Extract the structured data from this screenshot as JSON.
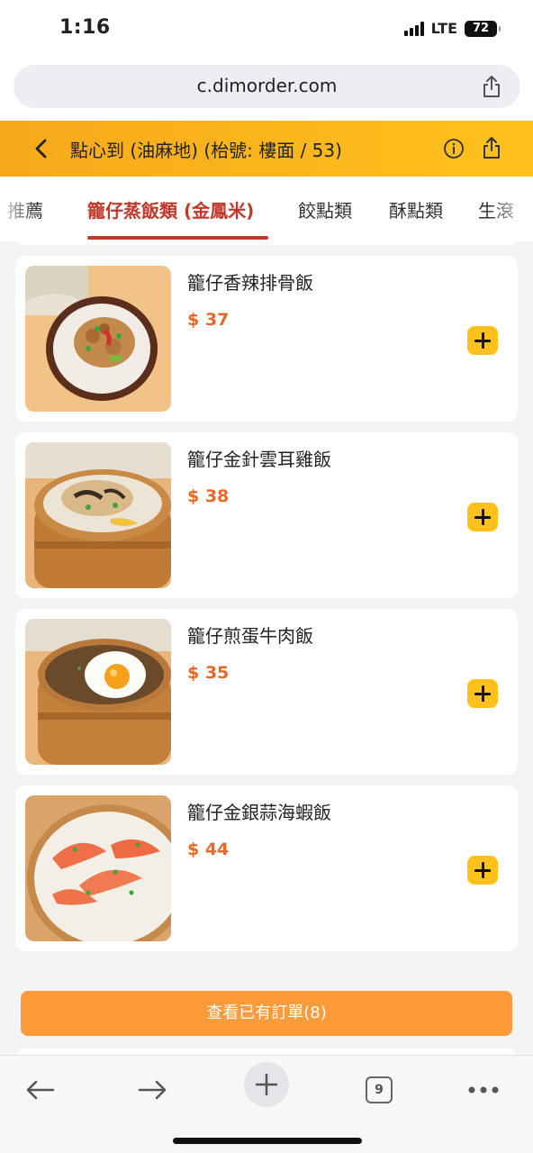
{
  "status": {
    "time": "1:16",
    "network": "LTE",
    "battery": "72"
  },
  "browser": {
    "url": "c.dimorder.com",
    "tab_count": "9"
  },
  "header": {
    "title": "點心到 (油麻地) (枱號: 樓面 / 53)"
  },
  "tabs": [
    {
      "label": "推薦",
      "active": false
    },
    {
      "label": "籠仔蒸飯類 (金鳳米)",
      "active": true
    },
    {
      "label": "餃點類",
      "active": false
    },
    {
      "label": "酥點類",
      "active": false
    },
    {
      "label": "生滾",
      "active": false
    }
  ],
  "items": [
    {
      "name": "籠仔香辣排骨飯",
      "price": "$ 37",
      "image": "spicy-pork-rib-rice"
    },
    {
      "name": "籠仔金針雲耳雞飯",
      "price": "$ 38",
      "image": "chicken-fungus-rice"
    },
    {
      "name": "籠仔煎蛋牛肉飯",
      "price": "$ 35",
      "image": "fried-egg-beef-rice"
    },
    {
      "name": "籠仔金銀蒜海蝦飯",
      "price": "$ 44",
      "image": "garlic-prawn-rice"
    }
  ],
  "order_button": "查看已有訂單(8)",
  "colors": {
    "brand_orange": "#ffc21d",
    "active_tab": "#c0392b",
    "price": "#e8682a",
    "order_button": "#fd9a3a"
  }
}
